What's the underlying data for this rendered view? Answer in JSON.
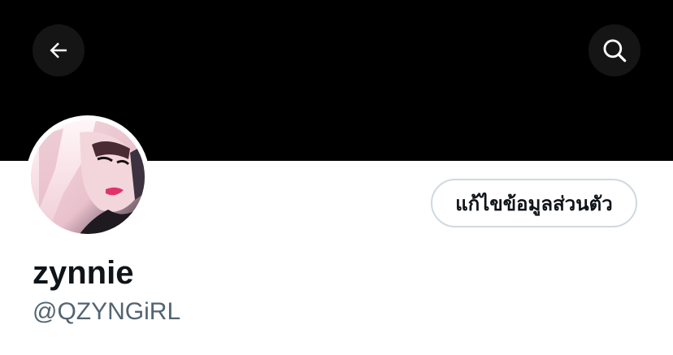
{
  "header": {
    "back_icon": "arrow-left-icon",
    "search_icon": "search-icon"
  },
  "profile": {
    "display_name": "zynnie",
    "handle": "@QZYNGiRL",
    "edit_button_label": "แก้ไขข้อมูลส่วนตัว"
  },
  "colors": {
    "banner": "#000000",
    "text_primary": "#0f1419",
    "text_secondary": "#536471",
    "button_border": "#cfd9de"
  }
}
